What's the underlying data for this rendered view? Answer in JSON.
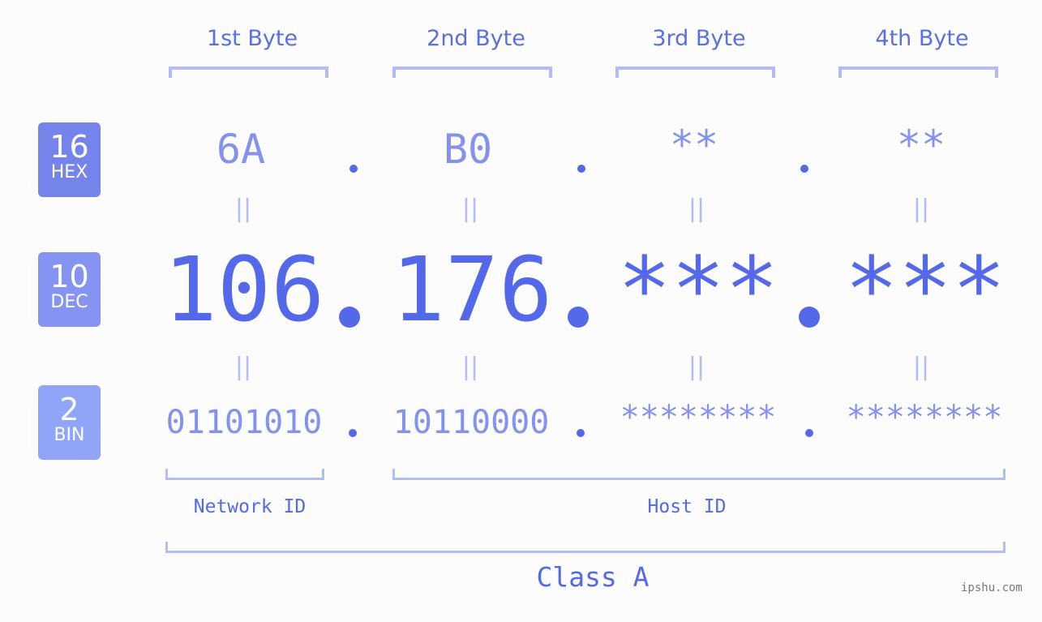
{
  "bytes": [
    {
      "header": "1st Byte",
      "hex": "6A",
      "dec": "106",
      "bin": "01101010"
    },
    {
      "header": "2nd Byte",
      "hex": "B0",
      "dec": "176",
      "bin": "10110000"
    },
    {
      "header": "3rd Byte",
      "hex": "**",
      "dec": "***",
      "bin": "********"
    },
    {
      "header": "4th Byte",
      "hex": "**",
      "dec": "***",
      "bin": "********"
    }
  ],
  "badges": {
    "hex": {
      "number": "16",
      "label": "HEX",
      "color": "#7584ea"
    },
    "dec": {
      "number": "10",
      "label": "DEC",
      "color": "#8594f2"
    },
    "bin": {
      "number": "2",
      "label": "BIN",
      "color": "#90a4f8"
    }
  },
  "equals_symbol": "||",
  "segments": {
    "network": "Network ID",
    "host": "Host ID",
    "class": "Class A"
  },
  "watermark": "ipshu.com",
  "colors": {
    "accent": "#5469ea",
    "light_accent": "#8491ee",
    "bracket": "#b3bcf6",
    "background": "#fbfcfb"
  }
}
